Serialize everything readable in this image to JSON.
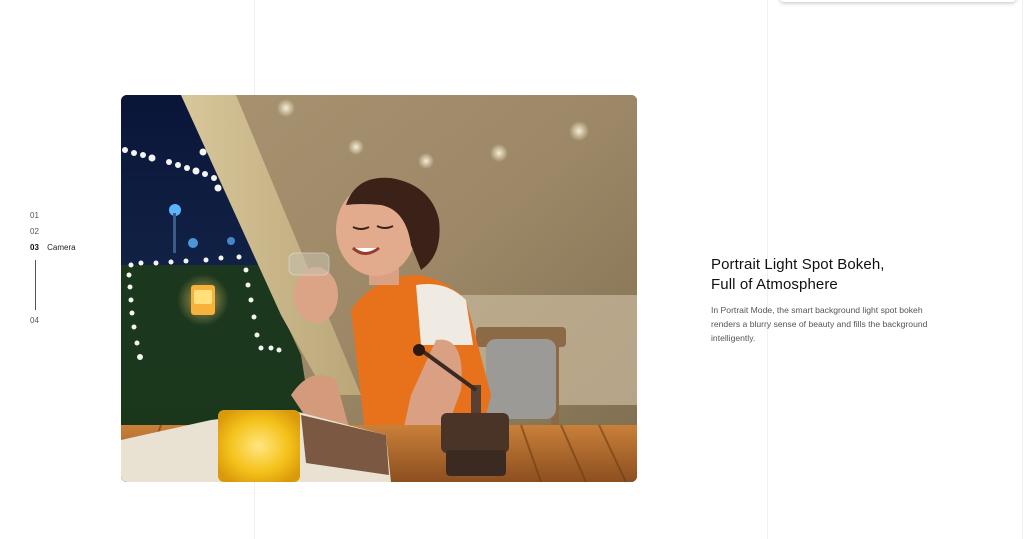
{
  "nav": {
    "items": [
      {
        "number": "01",
        "label": ""
      },
      {
        "number": "02",
        "label": ""
      },
      {
        "number": "03",
        "label": "Camera"
      },
      {
        "number": "04",
        "label": ""
      }
    ],
    "active_index": 2
  },
  "feature": {
    "title_line1": "Portrait Light Spot Bokeh,",
    "title_line2": "Full of Atmosphere",
    "description": "In Portrait Mode, the smart background light spot bokeh renders a blurry sense of beauty and fills the background intelligently."
  },
  "photo": {
    "subject": "woman holding glass in tent with bokeh lights at night"
  },
  "colors": {
    "accent_orange": "#e8721c",
    "tent_beige": "#b59a6f",
    "night_blue": "#0d1a3c",
    "candle_yellow": "#f5c21b"
  }
}
